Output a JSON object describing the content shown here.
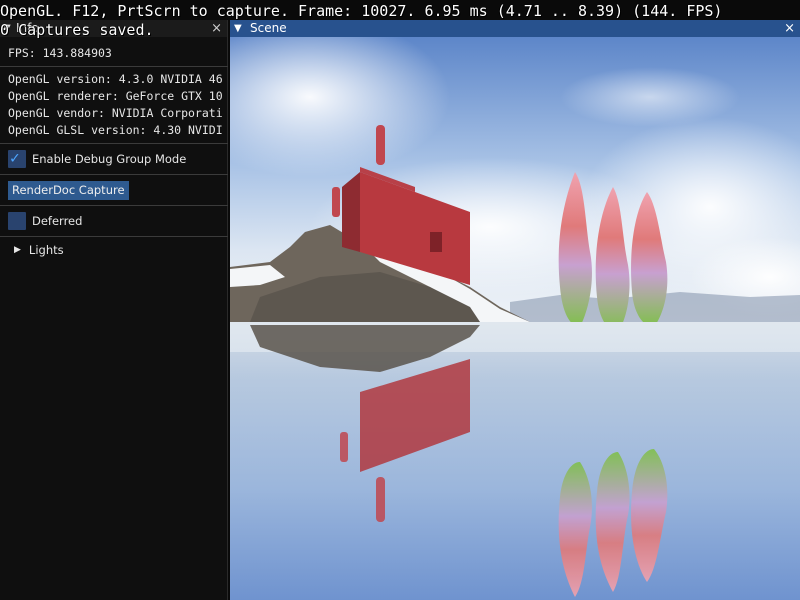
{
  "overlay": {
    "line1": "OpenGL. F12, PrtScrn to capture. Frame: 10027. 6.95 ms (4.71 .. 8.39) (144. FPS)",
    "line2": "0 Captures saved."
  },
  "debug_panel": {
    "title": "Info",
    "fps": "FPS: 143.884903",
    "gl_version": "OpenGL version: 4.3.0 NVIDIA 46",
    "gl_renderer": "OpenGL renderer: GeForce GTX 10",
    "gl_vendor": "OpenGL vendor: NVIDIA Corporati",
    "gl_glsl": "OpenGL GLSL version: 4.30 NVIDI",
    "debug_group_label": "Enable Debug Group Mode",
    "debug_group_checked": true,
    "renderdoc_button": "RenderDoc Capture",
    "deferred_label": "Deferred",
    "deferred_checked": false,
    "lights_label": "Lights"
  },
  "scene_window": {
    "title": "Scene",
    "close_label": "×"
  },
  "colors": {
    "accent": "#28528e",
    "checkbox_fill": "#29436e",
    "check_mark": "#4ea6ff",
    "button_bg": "#2e5a8f",
    "panel_bg": "#0f0f0f"
  },
  "icons": {
    "collapse": "triangle-down-icon",
    "close": "close-icon",
    "check": "checkmark-icon",
    "tree": "triangle-right-icon"
  }
}
